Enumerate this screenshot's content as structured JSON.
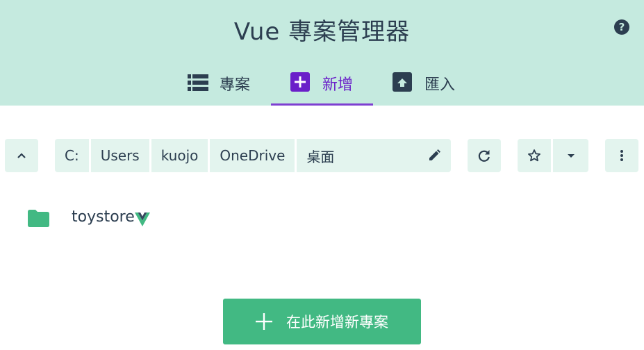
{
  "header": {
    "title": "Vue 專案管理器",
    "help_label": "?"
  },
  "tabs": [
    {
      "label": "專案",
      "icon": "list-icon",
      "active": false
    },
    {
      "label": "新增",
      "icon": "add-box-icon",
      "active": true
    },
    {
      "label": "匯入",
      "icon": "unarchive-icon",
      "active": false
    }
  ],
  "path": {
    "segments": [
      "C:",
      "Users",
      "kuojo",
      "OneDrive",
      "桌面"
    ]
  },
  "folders": [
    {
      "name": "toystore",
      "is_vue_project": true
    }
  ],
  "create_button": {
    "label": "在此新增新專案"
  },
  "colors": {
    "header_bg": "#c5eadf",
    "accent_purple": "#6a1fc9",
    "primary_green": "#42b983",
    "toolbar_bg": "#e3f4ee",
    "text": "#2c3e50"
  }
}
